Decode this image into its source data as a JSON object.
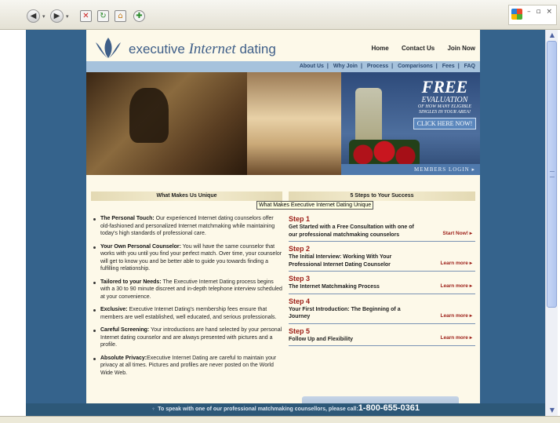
{
  "colors": {
    "page_bg": "#35638c",
    "site_bg": "#fdf9e9",
    "accent_red": "#9c1d16",
    "nav_blue": "#a6c2dc"
  },
  "header": {
    "logo_word1": "executive",
    "logo_word2": "Internet",
    "logo_word3": "dating",
    "topnav": [
      "Home",
      "Contact Us",
      "Join Now"
    ],
    "subnav": [
      "About Us",
      "Why Join",
      "Process",
      "Comparisons",
      "Fees",
      "FAQ"
    ]
  },
  "hero": {
    "free": "FREE",
    "evaluation": "EVALUATION",
    "line1": "OF HOW MANY ELIGIBLE",
    "line2": "SINGLES IN YOUR AREA!",
    "click": "CLICK HERE NOW!",
    "members": "MEMBERS LOGIN ▸"
  },
  "sections": {
    "unique_title": "What Makes Us Unique",
    "steps_title": "5 Steps to Your Success",
    "tooltip": "What Makes Executive Internet Dating Unique"
  },
  "unique": [
    {
      "title": "The Personal Touch:",
      "body": " Our experienced Internet dating counselors offer old-fashioned and personalized Internet matchmaking while maintaining today's high standards of professional care."
    },
    {
      "title": "Your Own Personal Counselor:",
      "body": "  You will have the same counselor that works with you until you find your perfect match. Over time, your counselor will get to know you and be better able to guide you towards finding a fulfilling relationship."
    },
    {
      "title": "Tailored to your Needs:",
      "body": " The Executive Internet Dating process begins with a 30 to 90 minute discreet and in-depth telephone interview scheduled at your convenience."
    },
    {
      "title": "Exclusive:",
      "body": " Executive Internet Dating's membership fees ensure that members are well established, well educated, and serious professionals."
    },
    {
      "title": "Careful Screening:",
      "body": " Your introductions are hand selected by your personal Internet dating counselor and are always presented with pictures and a profile."
    },
    {
      "title": "Absolute Privacy:",
      "body": "Executive Internet Dating are careful to maintain your privacy at all times. Pictures and profiles are never posted on the World Wide Web."
    }
  ],
  "steps": [
    {
      "n": "Step 1",
      "t": "Get Started with a Free Consultation with one of our professional matchmaking counselors",
      "more": "Start Now! ▸"
    },
    {
      "n": "Step 2",
      "t": "The Initial Interview: Working With Your Professional Internet Dating Counselor",
      "more": "Learn more ▸"
    },
    {
      "n": "Step 3",
      "t": "The Internet Matchmaking Process",
      "more": "Learn more ▸"
    },
    {
      "n": "Step 4",
      "t": "Your First Introduction: The Beginning of a Journey",
      "more": "Learn more ▸"
    },
    {
      "n": "Step 5",
      "t": "Follow Up and Flexibility",
      "more": "Learn more ▸"
    }
  ],
  "footer": {
    "text": "To speak with one of our professional matchmaking counsellors, please call:",
    "phone": "1-800-655-0361"
  }
}
